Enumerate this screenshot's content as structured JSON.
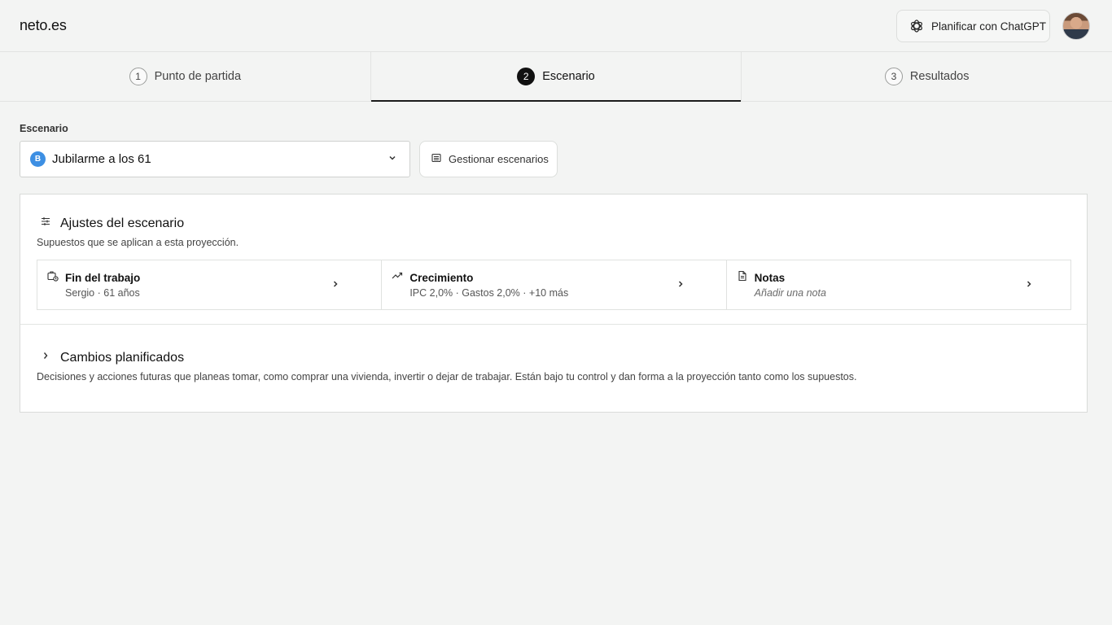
{
  "header": {
    "brand": "neto.es",
    "chatgpt_button": "Planificar con ChatGPT",
    "chatgpt_icon": "openai-icon",
    "avatar": "user-avatar"
  },
  "steps": [
    {
      "number": "1",
      "label": "Punto de partida",
      "active": false
    },
    {
      "number": "2",
      "label": "Escenario",
      "active": true
    },
    {
      "number": "3",
      "label": "Resultados",
      "active": false
    }
  ],
  "scenario": {
    "label": "Escenario",
    "badge": "B",
    "selected": "Jubilarme a los 61",
    "manage_button": "Gestionar escenarios"
  },
  "settings": {
    "title": "Ajustes del escenario",
    "subtitle": "Supuestos que se aplican a esta proyección.",
    "cards": [
      {
        "icon": "briefcase-clock-icon",
        "title": "Fin del trabajo",
        "subtitle": "Sergio · 61 años"
      },
      {
        "icon": "trending-up-icon",
        "title": "Crecimiento",
        "subtitle": "IPC 2,0% · Gastos 2,0% · +10 más"
      },
      {
        "icon": "document-icon",
        "title": "Notas",
        "subtitle": "Añadir una nota"
      }
    ]
  },
  "planned": {
    "title": "Cambios planificados",
    "description": "Decisiones y acciones futuras que planeas tomar, como comprar una vivienda, invertir o dejar de trabajar. Están bajo tu control y dan forma a la proyección tanto como los supuestos."
  }
}
